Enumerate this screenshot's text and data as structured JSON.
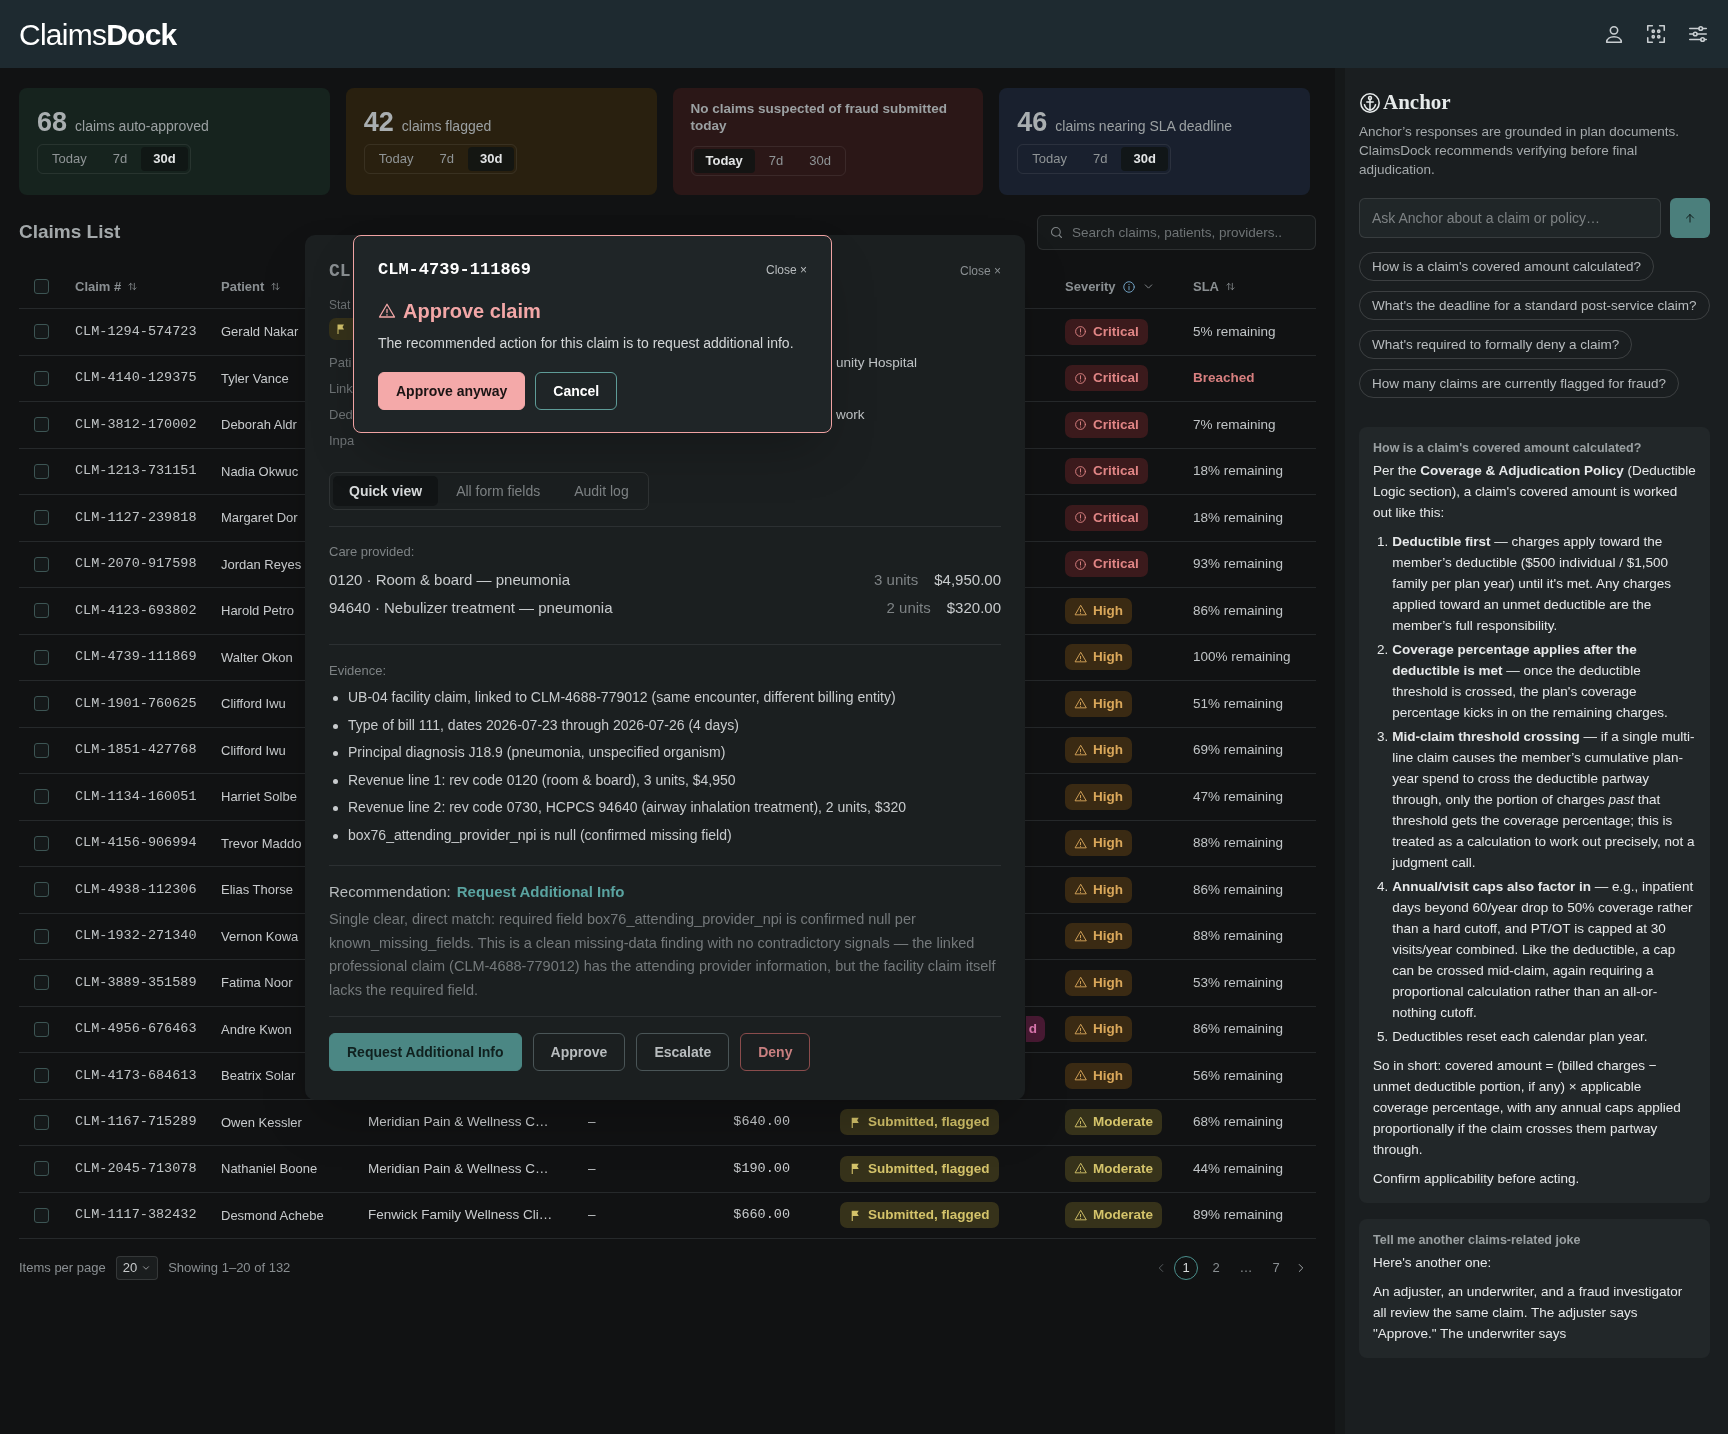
{
  "header": {
    "logo": "Claims**Dock**"
  },
  "stat_cards": [
    {
      "color": "#16231e",
      "value": "68",
      "label": "claims auto-approved",
      "ranges": [
        {
          "label": "Today",
          "selected": false
        },
        {
          "label": "7d",
          "selected": false
        },
        {
          "label": "30d",
          "selected": true
        }
      ]
    },
    {
      "color": "#29200f",
      "value": "42",
      "label": "claims flagged",
      "ranges": [
        {
          "label": "Today",
          "selected": false
        },
        {
          "label": "7d",
          "selected": false
        },
        {
          "label": "30d",
          "selected": true
        }
      ]
    },
    {
      "color": "#2b1717",
      "label": "No claims suspected of fraud submitted today",
      "ranges": [
        {
          "label": "Today",
          "selected": true
        },
        {
          "label": "7d",
          "selected": false
        },
        {
          "label": "30d",
          "selected": false
        }
      ]
    },
    {
      "color": "#19202e",
      "value": "46",
      "label": "claims nearing SLA deadline",
      "ranges": [
        {
          "label": "Today",
          "selected": false
        },
        {
          "label": "7d",
          "selected": false
        },
        {
          "label": "30d",
          "selected": true
        }
      ]
    }
  ],
  "claims_list": {
    "title": "Claims List",
    "search": {
      "placeholder": "Search claims, patients, providers.."
    }
  },
  "table": {
    "select_all_checked": false,
    "columns": [
      {
        "label": "Claim #",
        "kind": "sortable"
      },
      {
        "label": "Patient",
        "kind": "sortable"
      },
      {
        "label": "Severity",
        "kind": "info"
      },
      {
        "label": "SLA",
        "kind": "sortable"
      }
    ],
    "rows": [
      {
        "checked": false,
        "claim": "CLM-1294-574723",
        "patient": "Gerald Nakar",
        "severity": {
          "label": "Critical",
          "kind": "critical"
        },
        "sla": "5% remaining",
        "sla_breached": false
      },
      {
        "checked": false,
        "claim": "CLM-4140-129375",
        "patient": "Tyler Vance",
        "severity": {
          "label": "Critical",
          "kind": "critical"
        },
        "sla": "Breached",
        "sla_breached": true
      },
      {
        "checked": false,
        "claim": "CLM-3812-170002",
        "patient": "Deborah Aldr",
        "severity": {
          "label": "Critical",
          "kind": "critical"
        },
        "sla": "7% remaining",
        "sla_breached": false
      },
      {
        "checked": false,
        "claim": "CLM-1213-731151",
        "patient": "Nadia Okwuc",
        "severity": {
          "label": "Critical",
          "kind": "critical"
        },
        "sla": "18% remaining",
        "sla_breached": false
      },
      {
        "checked": false,
        "claim": "CLM-1127-239818",
        "patient": "Margaret Dor",
        "severity": {
          "label": "Critical",
          "kind": "critical"
        },
        "sla": "18% remaining",
        "sla_breached": false
      },
      {
        "checked": false,
        "claim": "CLM-2070-917598",
        "patient": "Jordan Reyes",
        "severity": {
          "label": "Critical",
          "kind": "critical"
        },
        "sla": "93% remaining",
        "sla_breached": false
      },
      {
        "checked": false,
        "claim": "CLM-4123-693802",
        "patient": "Harold Petro",
        "severity": {
          "label": "High",
          "kind": "high"
        },
        "sla": "86% remaining",
        "sla_breached": false
      },
      {
        "checked": false,
        "claim": "CLM-4739-111869",
        "patient": "Walter Okon",
        "severity": {
          "label": "High",
          "kind": "high"
        },
        "sla": "100% remaining",
        "sla_breached": false
      },
      {
        "checked": false,
        "claim": "CLM-1901-760625",
        "patient": "Clifford Iwu",
        "severity": {
          "label": "High",
          "kind": "high"
        },
        "sla": "51% remaining",
        "sla_breached": false
      },
      {
        "checked": false,
        "claim": "CLM-1851-427768",
        "patient": "Clifford Iwu",
        "severity": {
          "label": "High",
          "kind": "high"
        },
        "sla": "69% remaining",
        "sla_breached": false
      },
      {
        "checked": false,
        "claim": "CLM-1134-160051",
        "patient": "Harriet Solbe",
        "severity": {
          "label": "High",
          "kind": "high"
        },
        "sla": "47% remaining",
        "sla_breached": false
      },
      {
        "checked": false,
        "claim": "CLM-4156-906994",
        "patient": "Trevor Maddo",
        "severity": {
          "label": "High",
          "kind": "high"
        },
        "sla": "88% remaining",
        "sla_breached": false
      },
      {
        "checked": false,
        "claim": "CLM-4938-112306",
        "patient": "Elias Thorse",
        "severity": {
          "label": "High",
          "kind": "high"
        },
        "sla": "86% remaining",
        "sla_breached": false
      },
      {
        "checked": false,
        "claim": "CLM-1932-271340",
        "patient": "Vernon Kowa",
        "severity": {
          "label": "High",
          "kind": "high"
        },
        "sla": "88% remaining",
        "sla_breached": false
      },
      {
        "checked": false,
        "claim": "CLM-3889-351589",
        "patient": "Fatima Noor",
        "severity": {
          "label": "High",
          "kind": "high"
        },
        "sla": "53% remaining",
        "sla_breached": false
      },
      {
        "checked": false,
        "claim": "CLM-4956-676463",
        "patient": "Andre Kwon",
        "status": {
          "label": "d",
          "kind": "partial"
        },
        "severity": {
          "label": "High",
          "kind": "high"
        },
        "sla": "86% remaining",
        "sla_breached": false
      },
      {
        "checked": false,
        "claim": "CLM-4173-684613",
        "patient": "Beatrix Solar",
        "severity": {
          "label": "High",
          "kind": "high"
        },
        "sla": "56% remaining",
        "sla_breached": false
      },
      {
        "checked": false,
        "claim": "CLM-1167-715289",
        "patient": "Owen Kessler",
        "provider": "Meridian Pain & Wellness C…",
        "column_4": "–",
        "amount": "$640.00",
        "status": {
          "label": "Submitted, flagged",
          "kind": "flagged"
        },
        "severity": {
          "label": "Moderate",
          "kind": "moderate"
        },
        "sla": "68% remaining",
        "sla_breached": false
      },
      {
        "checked": false,
        "claim": "CLM-2045-713078",
        "patient": "Nathaniel Boone",
        "provider": "Meridian Pain & Wellness C…",
        "column_4": "–",
        "amount": "$190.00",
        "status": {
          "label": "Submitted, flagged",
          "kind": "flagged"
        },
        "severity": {
          "label": "Moderate",
          "kind": "moderate"
        },
        "sla": "44% remaining",
        "sla_breached": false
      },
      {
        "checked": false,
        "claim": "CLM-1117-382432",
        "patient": "Desmond Achebe",
        "provider": "Fenwick Family Wellness Cli…",
        "column_4": "–",
        "amount": "$660.00",
        "status": {
          "label": "Submitted, flagged",
          "kind": "flagged"
        },
        "severity": {
          "label": "Moderate",
          "kind": "moderate"
        },
        "sla": "89% remaining",
        "sla_breached": false
      }
    ]
  },
  "pagination": {
    "items_per_page_label": "Items per page",
    "page_size": "20",
    "showing": "Showing 1–20 of 132",
    "pages": [
      {
        "label": "1",
        "selected": true
      },
      {
        "label": "2",
        "selected": false
      },
      {
        "label": "…",
        "selected": false
      },
      {
        "label": "7",
        "selected": false
      }
    ]
  },
  "claim_drawer": {
    "title_fragment": "CL",
    "close": "Close ×",
    "status_label_fragment": "Stat",
    "fields": [
      {
        "label": "Pati",
        "value": "unity Hospital"
      },
      {
        "label": "Link"
      },
      {
        "label": "Ded",
        "value": "work"
      },
      {
        "label": "Inpa"
      }
    ],
    "tabs": [
      {
        "label": "Quick view",
        "selected": true
      },
      {
        "label": "All form fields",
        "selected": false
      },
      {
        "label": "Audit log",
        "selected": false
      }
    ],
    "care_provided": {
      "label": "Care provided:",
      "lines": [
        {
          "description": "0120 · Room & board — pneumonia",
          "units": "3 units",
          "amount": "$4,950.00"
        },
        {
          "description": "94640 · Nebulizer treatment — pneumonia",
          "units": "2 units",
          "amount": "$320.00"
        }
      ]
    },
    "evidence": {
      "label": "Evidence:",
      "items": [
        "UB-04 facility claim, linked to CLM-4688-779012 (same encounter, different billing entity)",
        "Type of bill 111, dates 2026-07-23 through 2026-07-26 (4 days)",
        "Principal diagnosis J18.9 (pneumonia, unspecified organism)",
        "Revenue line 1: rev code 0120 (room & board), 3 units, $4,950",
        "Revenue line 2: rev code 0730, HCPCS 94640 (airway inhalation treatment), 2 units, $320",
        "box76_attending_provider_npi is null (confirmed missing field)"
      ]
    },
    "recommendation": {
      "label": "Recommendation:",
      "action": "Request Additional Info",
      "rationale": "Single clear, direct match: required field box76_attending_provider_npi is confirmed null per known_missing_fields. This is a clean missing-data finding with no contradictory signals — the linked professional claim (CLM-4688-779012) has the attending provider information, but the facility claim itself lacks the required field."
    },
    "actions": [
      {
        "label": "Request Additional Info",
        "kind": "primary"
      },
      {
        "label": "Approve",
        "kind": "outline"
      },
      {
        "label": "Escalate",
        "kind": "outline"
      },
      {
        "label": "Deny",
        "kind": "danger"
      }
    ]
  },
  "confirm_dialog": {
    "claim_id": "CLM-4739-111869",
    "close": "Close ×",
    "title": "Approve claim",
    "message": "The recommended action for this claim is to request additional info.",
    "buttons": [
      {
        "label": "Approve anyway",
        "kind": "danger"
      },
      {
        "label": "Cancel",
        "kind": "outline"
      }
    ]
  },
  "assistant": {
    "title": "Anchor",
    "disclaimer": "Anchor’s responses are grounded in plan documents. ClaimsDock recommends verifying before final adjudication.",
    "input": {
      "placeholder": "Ask Anchor about a claim or policy…"
    },
    "suggestions": [
      "How is a claim's covered amount calculated?",
      "What's the deadline for a standard post-service claim?",
      "What's required to formally deny a claim?",
      "How many claims are currently flagged for fraud?"
    ],
    "messages": [
      {
        "question": "How is a claim's covered amount calculated?",
        "blocks": [
          {
            "kind": "paragraph",
            "text": "Per the **Coverage & Adjudication Policy** (Deductible Logic section), a claim's covered amount is worked out like this:"
          },
          {
            "kind": "list",
            "items": [
              {
                "number": "1.",
                "text": "**Deductible first** — charges apply toward the member’s deductible ($500 individual / $1,500 family per plan year) until it's met. Any charges applied toward an unmet deductible are the member’s full responsibility."
              },
              {
                "number": "2.",
                "text": "**Coverage percentage applies after the deductible is met** — once the deductible threshold is crossed, the plan's coverage percentage kicks in on the remaining charges."
              },
              {
                "number": "3.",
                "text": "**Mid-claim threshold crossing** — if a single multi-line claim causes the member’s cumulative plan-year spend to cross the deductible partway through, only the portion of charges *past* that threshold gets the coverage percentage; this is treated as a calculation to work out precisely, not a judgment call."
              },
              {
                "number": "4.",
                "text": "**Annual/visit caps also factor in** — e.g., inpatient days beyond 60/year drop to 50% coverage rather than a hard cutoff, and PT/OT is capped at 30 visits/year combined. Like the deductible, a cap can be crossed mid-claim, again requiring a proportional calculation rather than an all-or-nothing cutoff."
              },
              {
                "number": "5.",
                "text": "Deductibles reset each calendar plan year."
              }
            ]
          },
          {
            "kind": "paragraph",
            "text": "So in short: covered amount = (billed charges − unmet deductible portion, if any) × applicable coverage percentage, with any annual caps applied proportionally if the claim crosses them partway through."
          },
          {
            "kind": "paragraph",
            "text": "Confirm applicability before acting."
          }
        ]
      },
      {
        "question": "Tell me another claims-related joke",
        "blocks": [
          {
            "kind": "paragraph",
            "text": "Here's another one:"
          },
          {
            "kind": "paragraph",
            "text": "An adjuster, an underwriter, and a fraud investigator all review the same claim. The adjuster says \"Approve.\" The underwriter says"
          }
        ]
      }
    ]
  }
}
